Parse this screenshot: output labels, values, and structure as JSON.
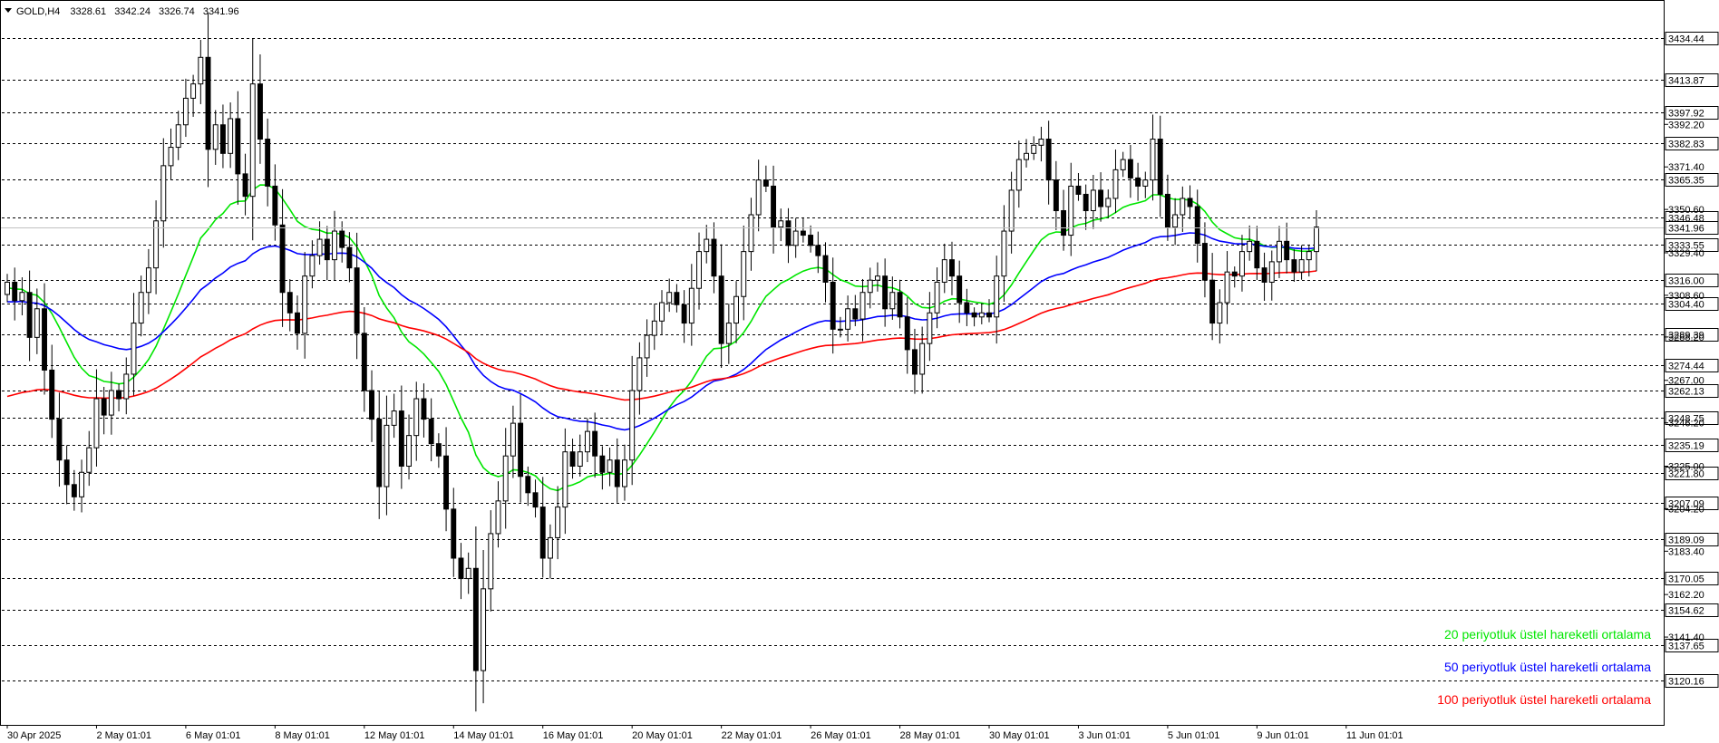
{
  "header": {
    "symbol": "GOLD,H4",
    "open": "3328.61",
    "high": "3342.24",
    "low": "3326.74",
    "close": "3341.96"
  },
  "legend": [
    {
      "text": "20 periyotluk üstel hareketli ortalama",
      "color": "#00e600"
    },
    {
      "text": "50 periyotluk üstel hareketli ortalama",
      "color": "#0000ff"
    },
    {
      "text": "100 periyotluk üstel hareketli ortalama",
      "color": "#ff0000"
    }
  ],
  "chart_data": {
    "type": "candlestick",
    "symbol": "GOLD",
    "timeframe": "H4",
    "ylim": [
      3110,
      3450
    ],
    "current_price": 3341.96,
    "level_lines": [
      3434.44,
      3413.87,
      3397.92,
      3382.83,
      3365.35,
      3346.48,
      3333.55,
      3316.0,
      3304.4,
      3289.39,
      3274.44,
      3262.13,
      3248.75,
      3235.19,
      3221.8,
      3207.09,
      3189.09,
      3170.05,
      3154.62,
      3137.65,
      3120.16
    ],
    "price_ticks": [
      "3392.20",
      "3371.40",
      "3350.60",
      "3329.40",
      "3308.60",
      "3288.20",
      "3267.00",
      "3246.20",
      "3225.00",
      "3204.20",
      "3183.40",
      "3162.20",
      "3141.40"
    ],
    "x_labels": [
      "30 Apr 2025",
      "2 May 01:01",
      "6 May 01:01",
      "8 May 01:01",
      "12 May 01:01",
      "14 May 01:01",
      "16 May 01:01",
      "20 May 01:01",
      "22 May 01:01",
      "26 May 01:01",
      "28 May 01:01",
      "30 May 01:01",
      "3 Jun 01:01",
      "5 Jun 01:01",
      "9 Jun 01:01",
      "11 Jun 01:01"
    ],
    "x_label_index": [
      0,
      12,
      24,
      36,
      48,
      60,
      72,
      84,
      96,
      108,
      120,
      132,
      144,
      156,
      168,
      180
    ],
    "closes": [
      3315,
      3306,
      3310,
      3288,
      3302,
      3272,
      3248,
      3228,
      3216,
      3210,
      3222,
      3234,
      3258,
      3250,
      3262,
      3258,
      3270,
      3295,
      3310,
      3322,
      3345,
      3372,
      3381,
      3392,
      3405,
      3412,
      3425,
      3380,
      3392,
      3378,
      3395,
      3368,
      3357,
      3412,
      3385,
      3362,
      3343,
      3310,
      3300,
      3290,
      3318,
      3328,
      3336,
      3326,
      3340,
      3332,
      3322,
      3290,
      3262,
      3248,
      3215,
      3245,
      3252,
      3225,
      3240,
      3258,
      3248,
      3236,
      3230,
      3204,
      3180,
      3170,
      3175,
      3125,
      3165,
      3192,
      3208,
      3230,
      3246,
      3220,
      3212,
      3205,
      3180,
      3190,
      3205,
      3232,
      3225,
      3232,
      3242,
      3230,
      3222,
      3228,
      3215,
      3228,
      3262,
      3278,
      3289,
      3296,
      3305,
      3310,
      3304,
      3295,
      3312,
      3330,
      3336,
      3318,
      3285,
      3295,
      3308,
      3330,
      3348,
      3365,
      3362,
      3342,
      3345,
      3333,
      3340,
      3338,
      3333,
      3328,
      3315,
      3292,
      3292,
      3302,
      3297,
      3310,
      3316,
      3318,
      3302,
      3310,
      3298,
      3282,
      3270,
      3285,
      3300,
      3315,
      3326,
      3318,
      3305,
      3300,
      3298,
      3300,
      3298,
      3318,
      3340,
      3360,
      3375,
      3378,
      3382,
      3385,
      3365,
      3350,
      3338,
      3362,
      3358,
      3350,
      3360,
      3352,
      3356,
      3370,
      3375,
      3366,
      3362,
      3365,
      3385,
      3358,
      3342,
      3348,
      3356,
      3352,
      3334,
      3316,
      3295,
      3305,
      3320,
      3318,
      3330,
      3335,
      3322,
      3315,
      3325,
      3335,
      3326,
      3320,
      3326,
      3330,
      3342
    ]
  }
}
